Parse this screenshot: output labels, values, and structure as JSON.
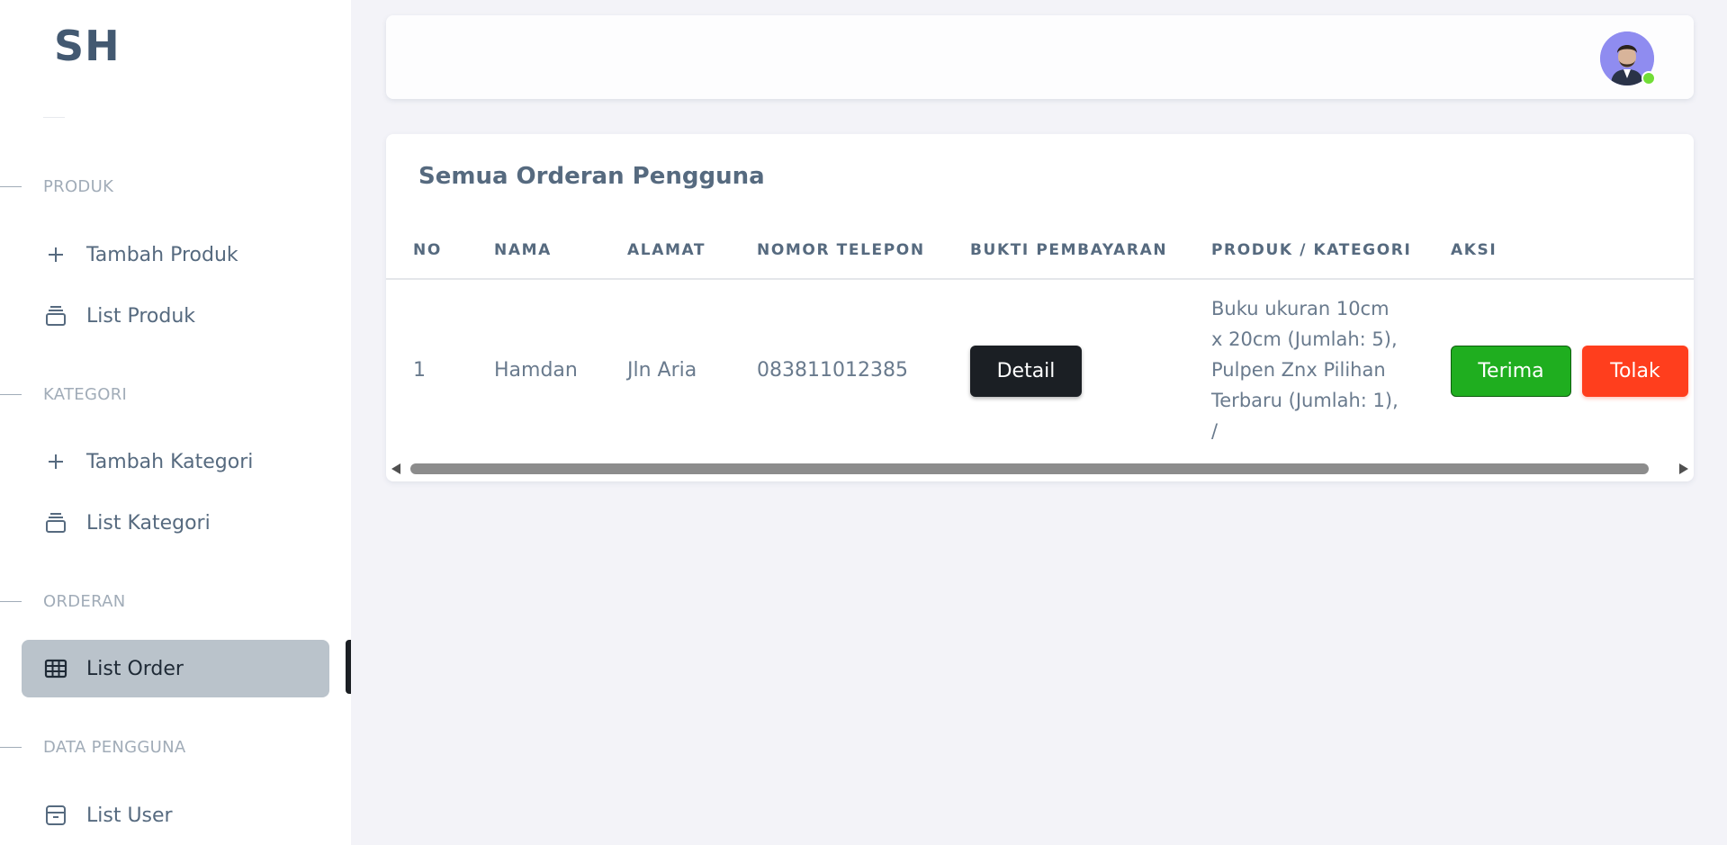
{
  "brand": "SH",
  "sidebar": {
    "sections": [
      {
        "label": "PRODUK"
      },
      {
        "label": "KATEGORI"
      },
      {
        "label": "ORDERAN"
      },
      {
        "label": "DATA PENGGUNA"
      }
    ],
    "items": [
      {
        "label": "Tambah Produk",
        "icon": "plus-icon"
      },
      {
        "label": "List Produk",
        "icon": "stack-icon"
      },
      {
        "label": "Tambah Kategori",
        "icon": "plus-icon"
      },
      {
        "label": "List Kategori",
        "icon": "stack-icon"
      },
      {
        "label": "List Order",
        "icon": "table-icon",
        "active": true
      },
      {
        "label": "List User",
        "icon": "archive-icon"
      }
    ]
  },
  "card": {
    "title": "Semua Orderan Pengguna",
    "columns": [
      "NO",
      "NAMA",
      "ALAMAT",
      "NOMOR TELEPON",
      "BUKTI PEMBAYARAN",
      "PRODUK / KATEGORI",
      "AKSI"
    ],
    "rows": [
      {
        "no": "1",
        "nama": "Hamdan",
        "alamat": "Jln Aria",
        "telepon": "083811012385",
        "bukti_label": "Detail",
        "produk_lines": [
          "Buku ukuran 10cm",
          "x 20cm (Jumlah: 5),",
          "Pulpen Znx Pilihan",
          "Terbaru (Jumlah: 1),",
          "/"
        ],
        "terima_label": "Terima",
        "tolak_label": "Tolak"
      }
    ]
  },
  "colors": {
    "accent_active": "#bac3cb",
    "terima": "#1fae1f",
    "tolak": "#ff3e1d",
    "detail": "#1b1f24",
    "online": "#71dd37"
  }
}
